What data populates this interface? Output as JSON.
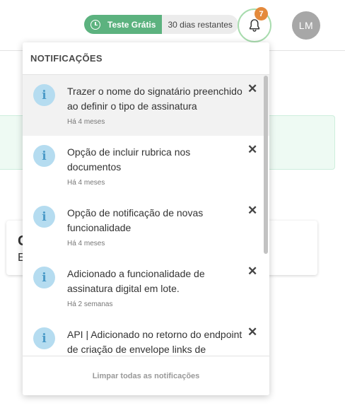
{
  "header": {
    "trial_label": "Teste Grátis",
    "trial_remaining": "30 dias restantes",
    "notification_count": "7",
    "avatar_initials": "LM"
  },
  "background": {
    "card_title": "C",
    "card_subtitle": "E"
  },
  "notifications": {
    "title": "NOTIFICAÇÕES",
    "items": [
      {
        "text": "Trazer o nome do signatário preenchido ao definir o tipo de assinatura",
        "time": "Há 4 meses",
        "icon": "info-icon",
        "close": "✕"
      },
      {
        "text": "Opção de incluir rubrica nos documentos",
        "time": "Há 4 meses",
        "icon": "info-icon",
        "close": "✕"
      },
      {
        "text": "Opção de notificação de novas funcionalidade",
        "time": "Há 4 meses",
        "icon": "info-icon",
        "close": "✕"
      },
      {
        "text": "Adicionado a funcionalidade de assinatura digital em lote.",
        "time": "Há 2 semanas",
        "icon": "info-icon",
        "close": "✕"
      },
      {
        "text": "API | Adicionado no retorno do endpoint de criação de envelope links de",
        "time": "",
        "icon": "info-icon",
        "close": "✕"
      }
    ],
    "clear_all": "Limpar todas as notificações"
  },
  "colors": {
    "trial_green": "#5cb27f",
    "badge_orange": "#e48a3c",
    "info_blue": "#b5dcf0",
    "bell_ring": "#a8dcae"
  }
}
